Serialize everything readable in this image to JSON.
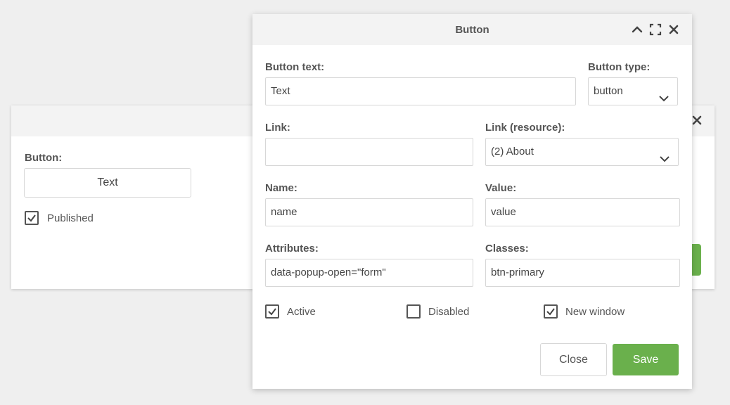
{
  "background_dialog": {
    "button_label": "Button:",
    "button_text": "Text",
    "published_label": "Published",
    "published_checked": true,
    "close_icon": "close-icon"
  },
  "dialog": {
    "title": "Button",
    "header_icons": [
      "chevron-up-icon",
      "fullscreen-icon",
      "close-icon"
    ],
    "fields": {
      "button_text": {
        "label": "Button text:",
        "value": "Text"
      },
      "button_type": {
        "label": "Button type:",
        "value": "button"
      },
      "link": {
        "label": "Link:",
        "value": ""
      },
      "link_resource": {
        "label": "Link (resource):",
        "value": "(2) About"
      },
      "name": {
        "label": "Name:",
        "value": "name"
      },
      "value": {
        "label": "Value:",
        "value": "value"
      },
      "attributes": {
        "label": "Attributes:",
        "value": "data-popup-open=\"form\""
      },
      "classes": {
        "label": "Classes:",
        "value": "btn-primary"
      }
    },
    "checkboxes": [
      {
        "label": "Active",
        "checked": true
      },
      {
        "label": "Disabled",
        "checked": false
      },
      {
        "label": "New window",
        "checked": true
      }
    ],
    "buttons": {
      "close": "Close",
      "save": "Save"
    }
  },
  "colors": {
    "accent_green": "#6ab04c",
    "header_bg": "#f3f3f3",
    "page_bg": "#efefef"
  }
}
